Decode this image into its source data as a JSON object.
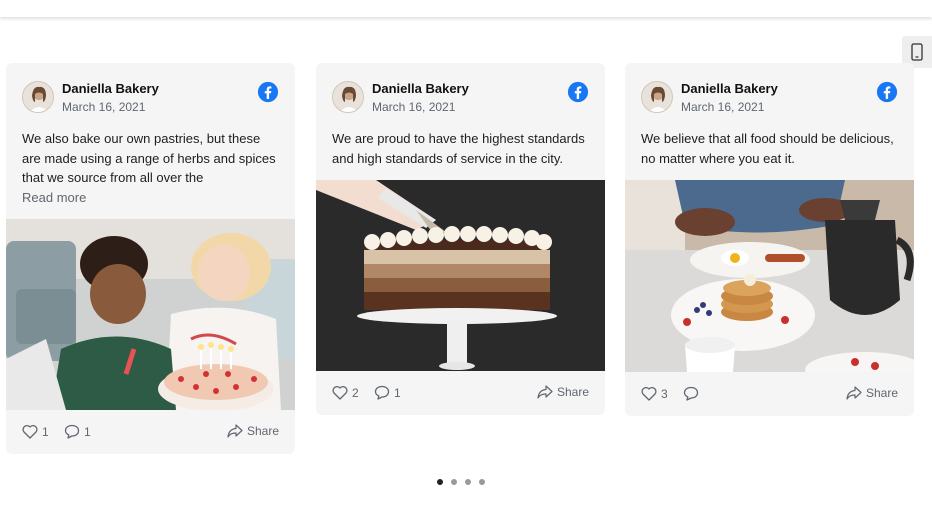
{
  "posts": [
    {
      "author": "Daniella Bakery",
      "date": "March 16, 2021",
      "text": "We also bake our own pastries, but these are made using a range of herbs and spices that we source from all over the",
      "read_more": "Read more",
      "likes": "1",
      "comments": "1",
      "share_label": "Share",
      "image_subject": "kids-with-birthday-cake-photo"
    },
    {
      "author": "Daniella Bakery",
      "date": "March 16, 2021",
      "text": "We are proud to have the highest standards and high standards of service in the city.",
      "likes": "2",
      "comments": "1",
      "share_label": "Share",
      "image_subject": "chocolate-ombre-cake-photo"
    },
    {
      "author": "Daniella Bakery",
      "date": "March 16, 2021",
      "text": "We believe that all food should be delicious, no matter where you eat it.",
      "likes": "3",
      "comments": "",
      "share_label": "Share",
      "image_subject": "pancake-breakfast-photo"
    }
  ],
  "pagination": {
    "total": 4,
    "active": 1
  },
  "colors": {
    "facebook": "#1877f2",
    "card_bg": "#f5f5f6",
    "muted": "#606770"
  }
}
